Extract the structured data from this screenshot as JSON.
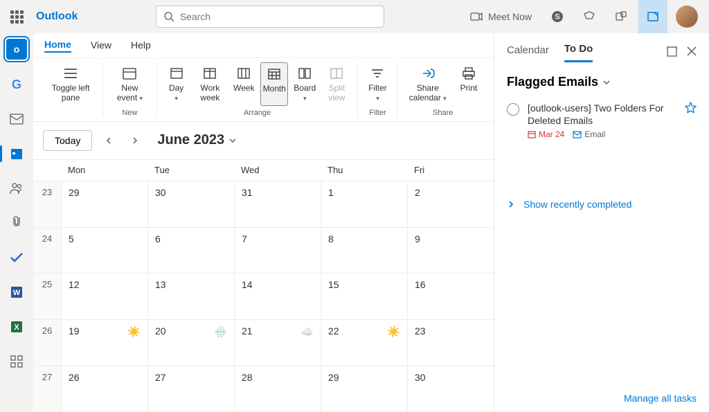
{
  "brand": "Outlook",
  "search_placeholder": "Search",
  "meet_now": "Meet Now",
  "tabs": {
    "home": "Home",
    "view": "View",
    "help": "Help"
  },
  "ribbon": {
    "toggle_pane": "Toggle left pane",
    "new_event": "New event",
    "day": "Day",
    "work_week": "Work week",
    "week": "Week",
    "month": "Month",
    "board": "Board",
    "split": "Split view",
    "filter": "Filter",
    "share_cal": "Share calendar",
    "print": "Print",
    "group_new": "New",
    "group_arrange": "Arrange",
    "group_filter": "Filter",
    "group_share": "Share"
  },
  "cal": {
    "today": "Today",
    "month_title": "June 2023",
    "weekdays": [
      "Mon",
      "Tue",
      "Wed",
      "Thu",
      "Fri"
    ],
    "weeks": [
      {
        "num": "23",
        "days": [
          {
            "d": "29"
          },
          {
            "d": "30"
          },
          {
            "d": "31"
          },
          {
            "d": "1"
          },
          {
            "d": "2"
          }
        ]
      },
      {
        "num": "24",
        "days": [
          {
            "d": "5"
          },
          {
            "d": "6"
          },
          {
            "d": "7"
          },
          {
            "d": "8"
          },
          {
            "d": "9"
          }
        ]
      },
      {
        "num": "25",
        "days": [
          {
            "d": "12"
          },
          {
            "d": "13"
          },
          {
            "d": "14"
          },
          {
            "d": "15"
          },
          {
            "d": "16"
          }
        ]
      },
      {
        "num": "26",
        "days": [
          {
            "d": "19",
            "w": "☀️"
          },
          {
            "d": "20",
            "w": "🌧️"
          },
          {
            "d": "21",
            "w": "☁️"
          },
          {
            "d": "22",
            "w": "☀️"
          },
          {
            "d": "23"
          }
        ]
      },
      {
        "num": "27",
        "days": [
          {
            "d": "26"
          },
          {
            "d": "27"
          },
          {
            "d": "28"
          },
          {
            "d": "29"
          },
          {
            "d": "30"
          }
        ]
      }
    ]
  },
  "todo": {
    "tab_cal": "Calendar",
    "tab_todo": "To Do",
    "section": "Flagged Emails",
    "task_title": "[outlook-users] Two Folders For Deleted Emails",
    "task_date": "Mar 24",
    "task_src": "Email",
    "show_completed": "Show recently completed",
    "manage": "Manage all tasks"
  }
}
